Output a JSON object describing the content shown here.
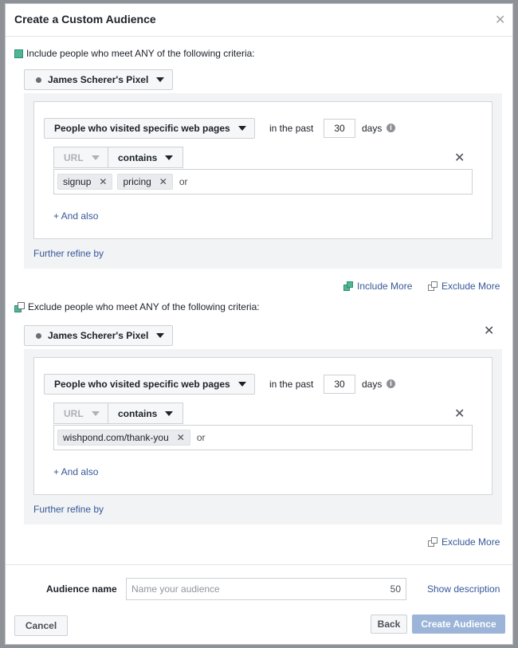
{
  "modal": {
    "title": "Create a Custom Audience"
  },
  "include": {
    "criteria_text": "Include people who meet ANY of the following criteria:",
    "pixel": "James Scherer's Pixel",
    "rule": {
      "event": "People who visited specific web pages",
      "in_the_past": "in the past",
      "days_value": "30",
      "days_label": "days",
      "url_label": "URL",
      "operator": "contains",
      "tokens": [
        "signup",
        "pricing"
      ],
      "or_label": "or",
      "and_also": "+ And also"
    },
    "further_refine": "Further refine by"
  },
  "actions": {
    "include_more": "Include More",
    "exclude_more": "Exclude More"
  },
  "exclude": {
    "criteria_text": "Exclude people who meet ANY of the following criteria:",
    "pixel": "James Scherer's Pixel",
    "rule": {
      "event": "People who visited specific web pages",
      "in_the_past": "in the past",
      "days_value": "30",
      "days_label": "days",
      "url_label": "URL",
      "operator": "contains",
      "tokens": [
        "wishpond.com/thank-you"
      ],
      "or_label": "or",
      "and_also": "+ And also"
    },
    "further_refine": "Further refine by",
    "exclude_more": "Exclude More"
  },
  "audience": {
    "label": "Audience name",
    "placeholder": "Name your audience",
    "char_count": "50",
    "show_description": "Show description"
  },
  "footer": {
    "cancel": "Cancel",
    "back": "Back",
    "create": "Create Audience"
  },
  "icons": {
    "close": "close-icon",
    "remove": "remove-icon",
    "info": "info-icon"
  },
  "colors": {
    "link": "#365899",
    "include_green": "#4fb693",
    "create_disabled": "#9cb4d8"
  }
}
